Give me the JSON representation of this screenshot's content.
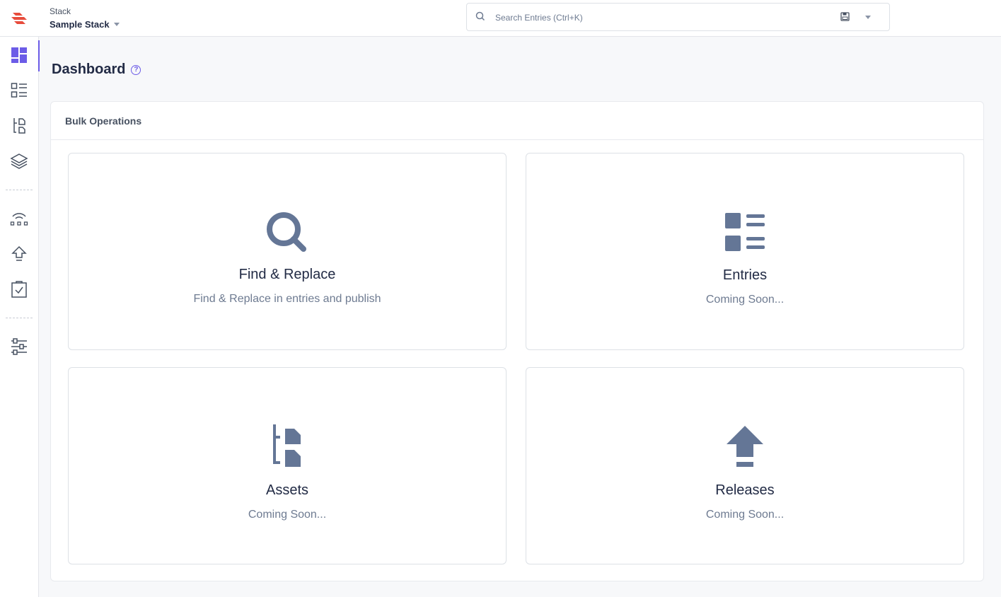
{
  "header": {
    "stack_label": "Stack",
    "stack_name": "Sample Stack",
    "search_placeholder": "Search Entries (Ctrl+K)"
  },
  "sidebar": {
    "items": [
      {
        "name": "dashboard",
        "icon": "dashboard-icon",
        "active": true
      },
      {
        "name": "entries",
        "icon": "entries-list-icon"
      },
      {
        "name": "assets",
        "icon": "assets-icon"
      },
      {
        "name": "content-models",
        "icon": "layers-icon"
      },
      {
        "name": "workflows",
        "icon": "workflow-icon"
      },
      {
        "name": "releases",
        "icon": "upload-icon"
      },
      {
        "name": "tasks",
        "icon": "clipboard-check-icon"
      },
      {
        "name": "settings",
        "icon": "sliders-icon"
      }
    ]
  },
  "page": {
    "title": "Dashboard"
  },
  "bulk": {
    "heading": "Bulk Operations",
    "cards": [
      {
        "title": "Find & Replace",
        "subtitle": "Find & Replace in entries and publish",
        "icon": "search-icon"
      },
      {
        "title": "Entries",
        "subtitle": "Coming Soon...",
        "icon": "entries-icon"
      },
      {
        "title": "Assets",
        "subtitle": "Coming Soon...",
        "icon": "assets-icon"
      },
      {
        "title": "Releases",
        "subtitle": "Coming Soon...",
        "icon": "release-upload-icon"
      }
    ]
  },
  "colors": {
    "accent": "#6c5ce7",
    "icon_slate": "#647696",
    "brand_red": "#e74c3c"
  }
}
